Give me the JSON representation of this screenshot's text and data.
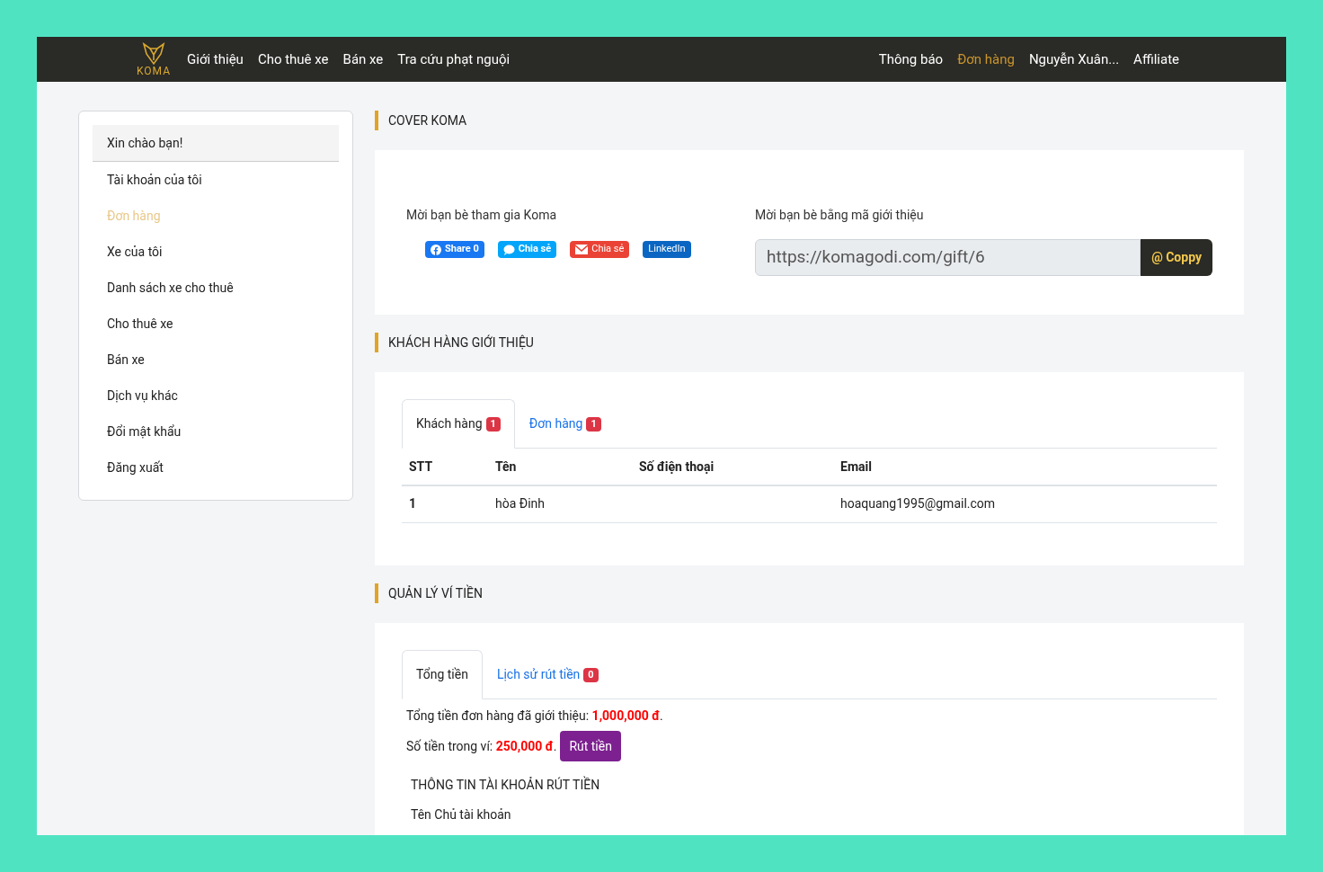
{
  "nav": {
    "brand": "KOMA",
    "left": [
      {
        "label": "Giới thiệu",
        "selected": false
      },
      {
        "label": "Cho thuê xe",
        "selected": false
      },
      {
        "label": "Bán xe",
        "selected": false
      },
      {
        "label": "Tra cứu phạt nguội",
        "selected": false
      }
    ],
    "right": [
      {
        "label": "Thông báo",
        "selected": false
      },
      {
        "label": "Đơn hàng",
        "selected": true
      },
      {
        "label": "Nguyễn Xuân...",
        "selected": false
      },
      {
        "label": "Affiliate",
        "selected": false
      }
    ]
  },
  "sidebar": {
    "greeting": "Xin chào bạn!",
    "items": [
      {
        "label": "Tài khoản của tôi",
        "selected": false
      },
      {
        "label": "Đơn hàng",
        "selected": true
      },
      {
        "label": "Xe của tôi",
        "selected": false
      },
      {
        "label": "Danh sách xe cho thuê",
        "selected": false
      },
      {
        "label": "Cho thuê xe",
        "selected": false
      },
      {
        "label": "Bán xe",
        "selected": false
      },
      {
        "label": "Dịch vụ khác",
        "selected": false
      },
      {
        "label": "Đổi mật khẩu",
        "selected": false
      },
      {
        "label": "Đăng xuất",
        "selected": false
      }
    ]
  },
  "cover": {
    "title": "COVER KOMA",
    "invite_label": "Mời bạn bè tham gia Koma",
    "share_buttons": [
      {
        "kind": "facebook",
        "label": "Share 0"
      },
      {
        "kind": "zalo",
        "label": "Chia sẻ"
      },
      {
        "kind": "email",
        "label": "Chia sẻ"
      },
      {
        "kind": "linkedin",
        "label": "LinkedIn"
      }
    ],
    "code_label": "Mời bạn bè bằng mã giới thiệu",
    "link": "https://komagodi.com/gift/6",
    "copy_button": "@ Coppy"
  },
  "referrals": {
    "title": "KHÁCH HÀNG GIỚI THIỆU",
    "tabs": [
      {
        "label": "Khách hàng",
        "count": "1",
        "selected": true
      },
      {
        "label": "Đơn hàng",
        "count": "1",
        "selected": false
      }
    ],
    "columns": [
      "STT",
      "Tên",
      "Số điện thoại",
      "Email"
    ],
    "rows": [
      [
        "1",
        "hòa Đinh",
        "",
        "hoaquang1995@gmail.com"
      ]
    ]
  },
  "wallet": {
    "title": "QUẢN LÝ VÍ TIỀN",
    "tabs": [
      {
        "label": "Tổng tiền",
        "selected": true
      },
      {
        "label": "Lịch sử rút tiền",
        "count": "0",
        "selected": false
      }
    ],
    "total_line": "Tổng tiền đơn hàng đã giới thiệu: **1,000,000 đ**.",
    "balance_line": "Số tiền trong ví: **250,000 đ**.",
    "withdraw_button": "Rút tiền",
    "account_title": "THÔNG TIN TÀI KHOẢN RÚT TIỀN",
    "account_holder_label": "Tên Chủ tài khoản"
  }
}
